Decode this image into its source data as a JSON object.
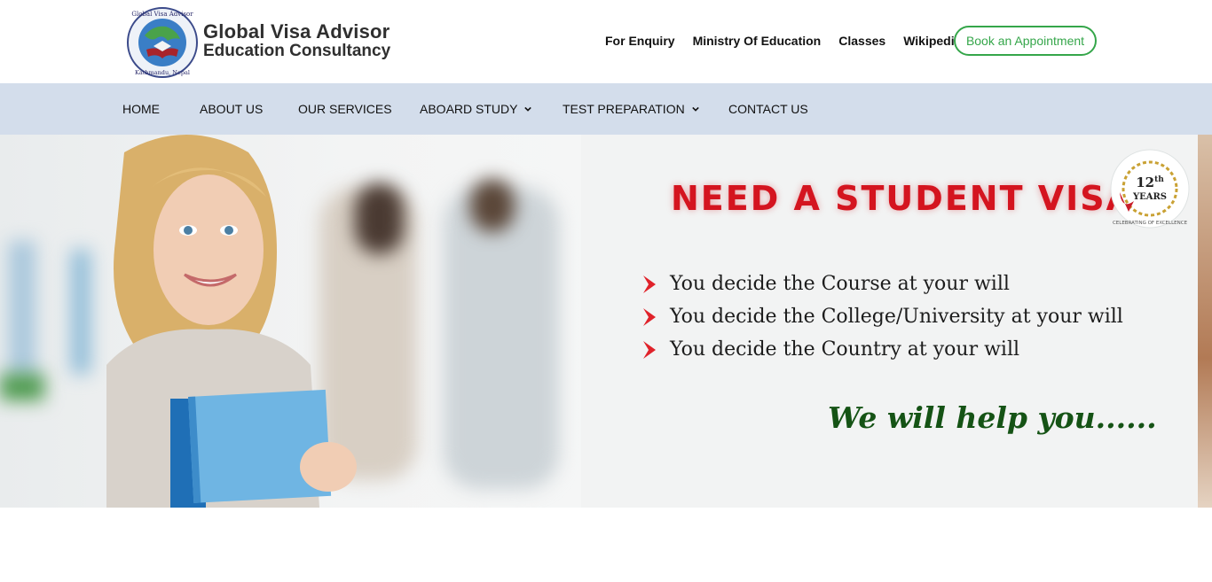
{
  "header": {
    "brand_line1": "Global Visa Advisor",
    "brand_line2": "Education Consultancy",
    "logo_text_top": "Global Visa Advisor",
    "logo_text_bottom": "Kathmandu, Nepal",
    "links": [
      "For Enquiry",
      "Ministry Of Education",
      "Classes",
      "Wikipedia"
    ],
    "book_button": "Book an Appointment"
  },
  "nav": {
    "items": [
      {
        "label": "HOME",
        "dropdown": false
      },
      {
        "label": "ABOUT US",
        "dropdown": false
      },
      {
        "label": "OUR SERVICES",
        "dropdown": false
      },
      {
        "label": "ABOARD STUDY",
        "dropdown": true
      },
      {
        "label": "TEST PREPARATION",
        "dropdown": true
      },
      {
        "label": "CONTACT US",
        "dropdown": false
      }
    ]
  },
  "hero": {
    "headline": "NEED A STUDENT VISA",
    "bullets": [
      "You decide the Course at your will",
      "You decide the College/University at your will",
      "You decide the Country at your will"
    ],
    "tagline": "We will help you......",
    "badge": {
      "number": "12",
      "suffix": "th",
      "word": "YEARS",
      "ring_text": "CELEBRATING OF EXCELLENCE"
    }
  },
  "colors": {
    "accent_green": "#35a64a",
    "nav_bg": "#d3ddeb",
    "headline_red": "#d4141f",
    "tagline_green": "#155315"
  }
}
